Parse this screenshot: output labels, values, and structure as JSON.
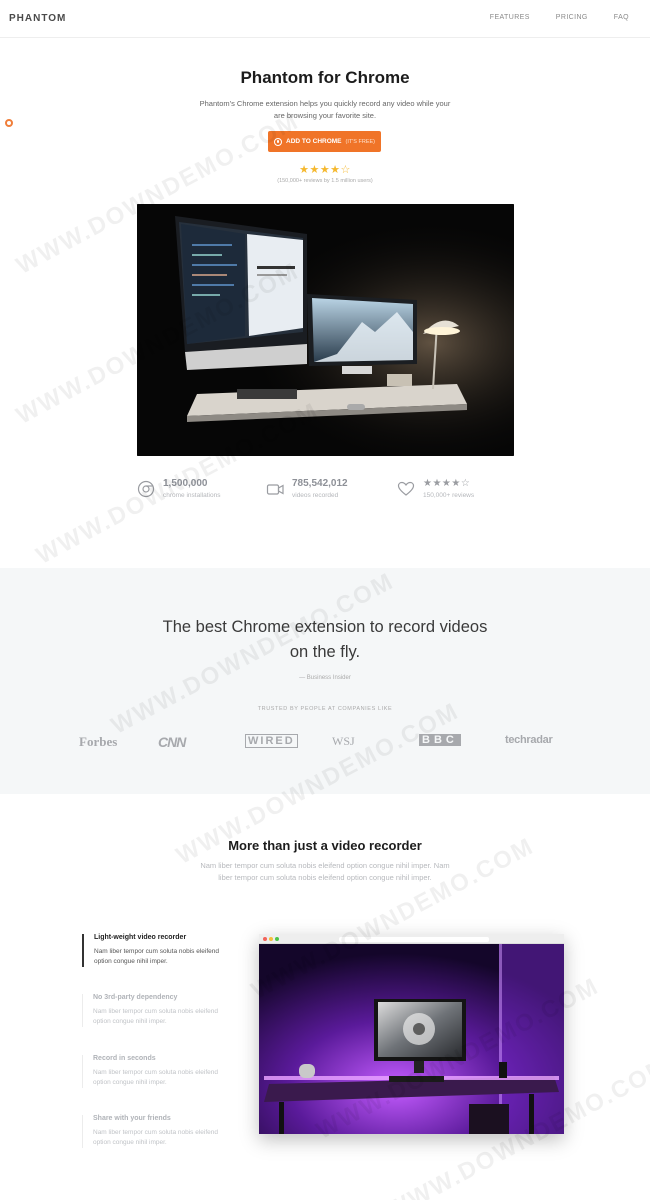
{
  "nav": {
    "brand": "PHANTOM",
    "links": [
      "FEATURES",
      "PRICING",
      "FAQ"
    ]
  },
  "hero": {
    "title": "Phantom for Chrome",
    "description": "Phantom's Chrome extension helps you quickly record any video while your are browsing your favorite site.",
    "cta_label": "ADD TO CHROME",
    "cta_note": "(IT'S FREE)",
    "stars": "★★★★☆",
    "rating_note": "(150,000+ reviews by 1.5 million users)"
  },
  "stats": [
    {
      "icon": "chrome-icon",
      "value": "1,500,000",
      "label": "chrome installations"
    },
    {
      "icon": "video-camera-icon",
      "value": "785,542,012",
      "label": "videos recorded"
    },
    {
      "icon": "heart-icon",
      "value": "★★★★☆",
      "label": "150,000+ reviews"
    }
  ],
  "quote": {
    "line1": "The best Chrome extension to record videos",
    "line2": "on the fly.",
    "source": "— Business Insider",
    "trusted": "TRUSTED BY PEOPLE AT COMPANIES LIKE"
  },
  "logos": [
    "Forbes",
    "CNN",
    "WIRED",
    "WSJ",
    "BBC",
    "techradar"
  ],
  "features": {
    "title": "More than just a video recorder",
    "description": "Nam liber tempor cum soluta nobis eleifend option congue nihil imper. Nam liber tempor cum soluta nobis eleifend option congue nihil imper.",
    "items": [
      {
        "title": "Light-weight video recorder",
        "text": "Nam liber tempor cum soluta nobis eleifend option congue nihil imper."
      },
      {
        "title": "No 3rd-party dependency",
        "text": "Nam liber tempor cum soluta nobis eleifend option congue nihil imper."
      },
      {
        "title": "Record in seconds",
        "text": "Nam liber tempor cum soluta nobis eleifend option congue nihil imper."
      },
      {
        "title": "Share with your friends",
        "text": "Nam liber tempor cum soluta nobis eleifend option congue nihil imper."
      }
    ]
  },
  "watermark": "WWW.DOWNDEMO.COM",
  "colors": {
    "accent": "#f07428",
    "star": "#f5b82e"
  }
}
